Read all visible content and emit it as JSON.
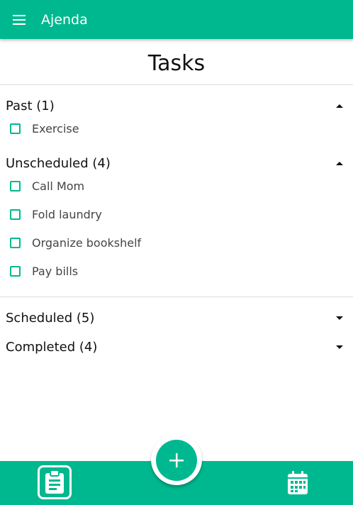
{
  "app": {
    "title": "Ajenda"
  },
  "page": {
    "title": "Tasks"
  },
  "sections": {
    "past": {
      "title": "Past (1)",
      "expanded": true,
      "tasks": [
        "Exercise"
      ]
    },
    "unscheduled": {
      "title": "Unscheduled (4)",
      "expanded": true,
      "tasks": [
        "Call Mom",
        "Fold laundry",
        "Organize bookshelf",
        "Pay bills"
      ]
    },
    "scheduled": {
      "title": "Scheduled (5)",
      "expanded": false
    },
    "completed": {
      "title": "Completed (4)",
      "expanded": false
    }
  },
  "icons": {
    "menu": "menu-icon",
    "collapse": "caret-up-icon",
    "expand": "caret-down-icon",
    "add": "plus-icon",
    "tasks_nav": "clipboard-icon",
    "calendar_nav": "calendar-icon"
  },
  "colors": {
    "accent": "#00b88f",
    "on_accent": "#ffffff",
    "divider": "#dcdcdc"
  }
}
